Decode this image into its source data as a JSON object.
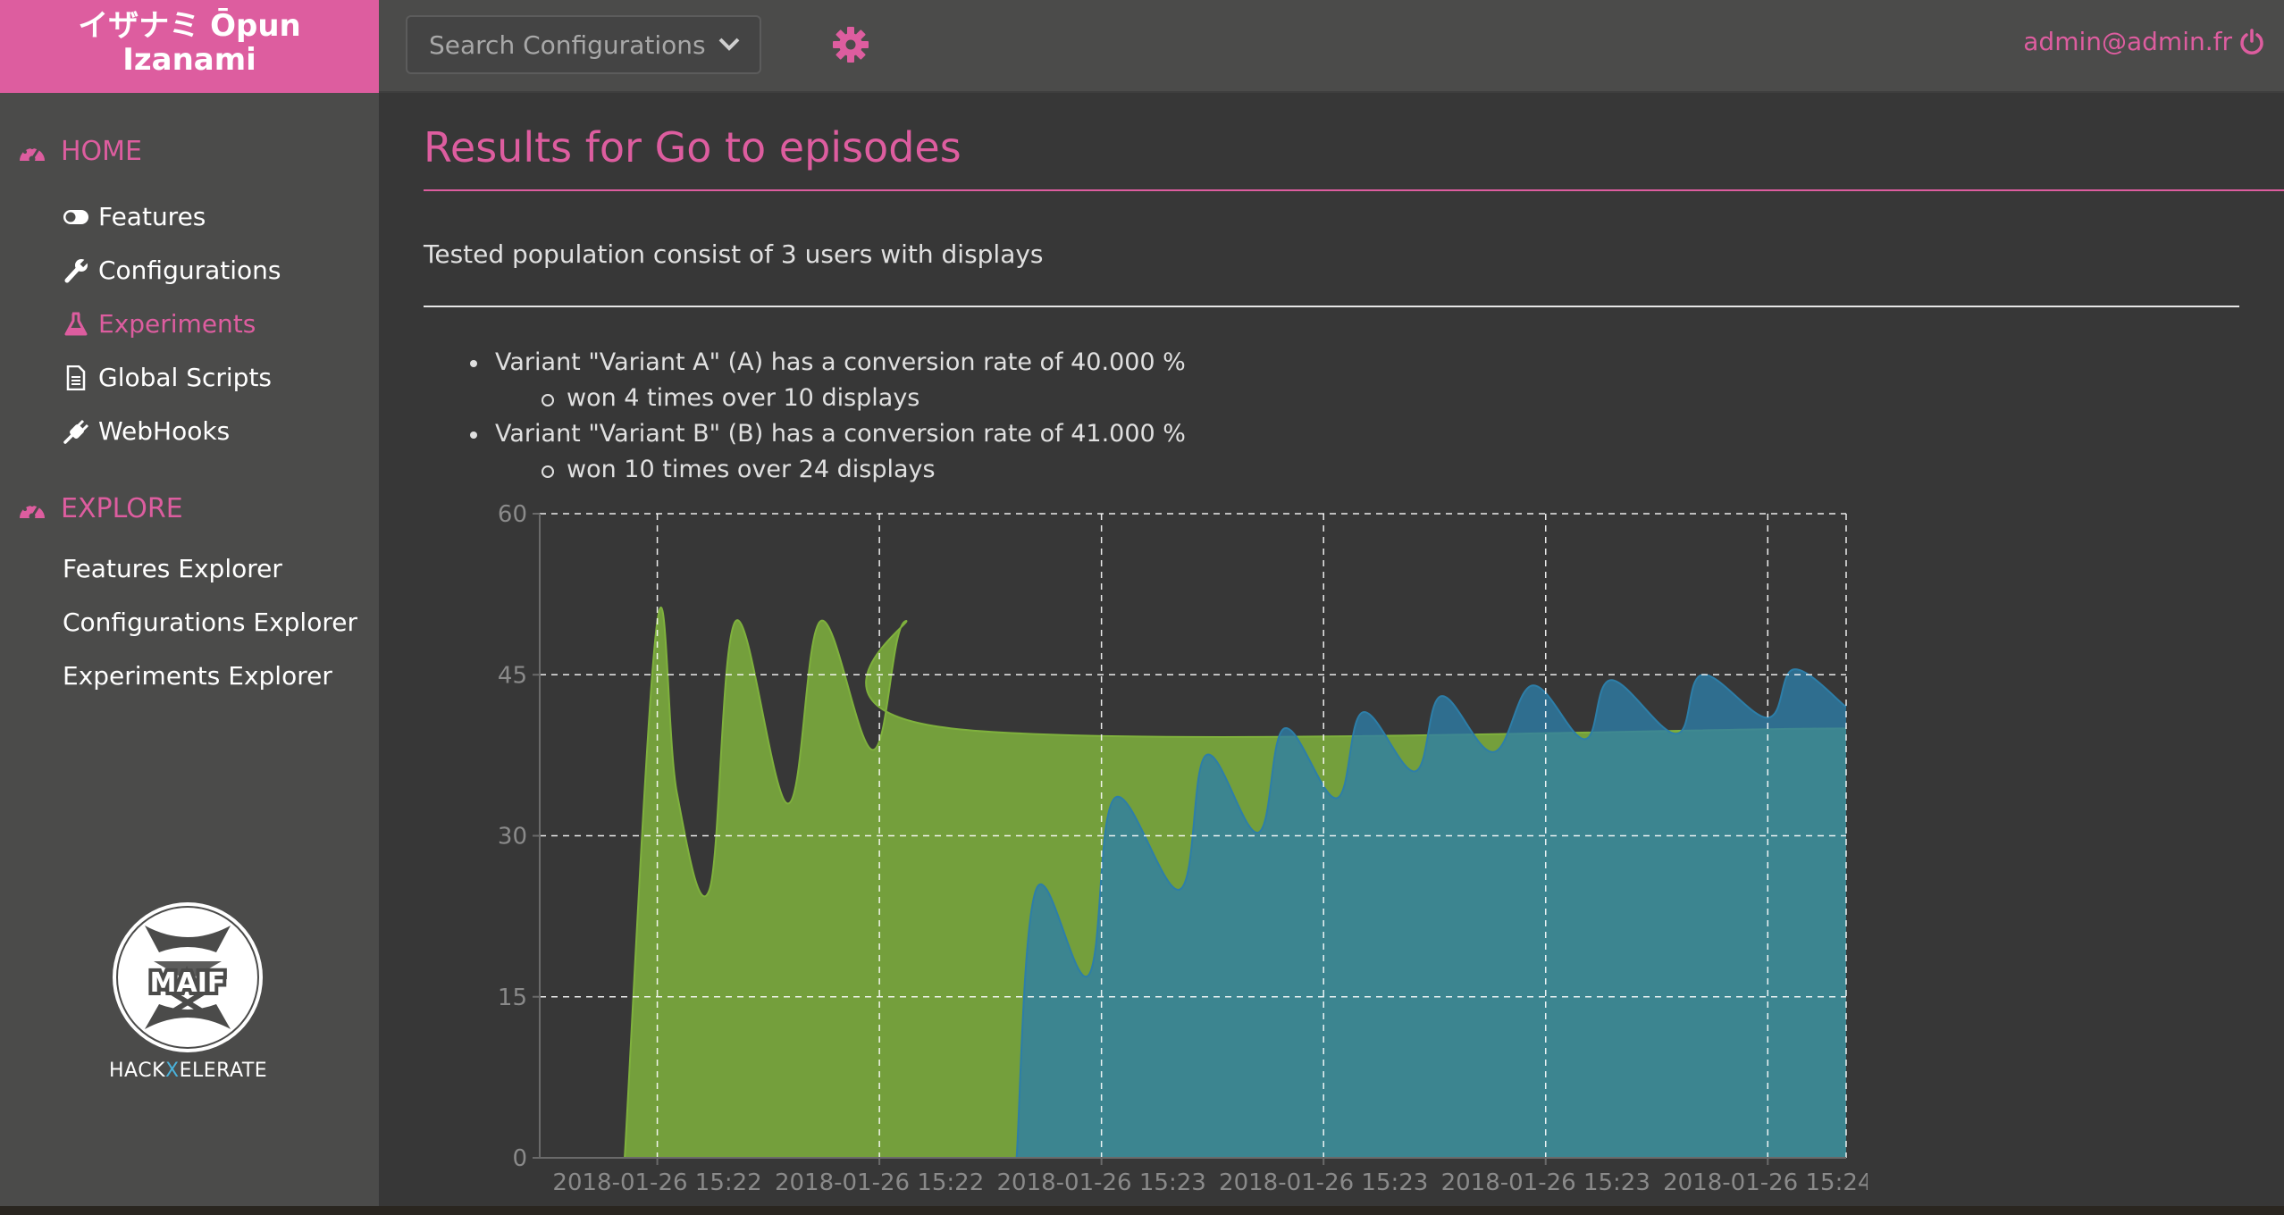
{
  "brand": {
    "line1": "イザナミ Ōpun",
    "line2": "Izanami"
  },
  "header": {
    "search_placeholder": "Search Configurations",
    "user_email": "admin@admin.fr",
    "accent_color": "#dd5d9f"
  },
  "sidebar": {
    "home_label": "HOME",
    "explore_label": "EXPLORE",
    "items": [
      {
        "label": "Features",
        "icon": "toggle-icon"
      },
      {
        "label": "Configurations",
        "icon": "wrench-icon"
      },
      {
        "label": "Experiments",
        "icon": "flask-icon",
        "active": true
      },
      {
        "label": "Global Scripts",
        "icon": "file-icon"
      },
      {
        "label": "WebHooks",
        "icon": "plug-icon"
      }
    ],
    "explore_items": [
      {
        "label": "Features Explorer"
      },
      {
        "label": "Configurations Explorer"
      },
      {
        "label": "Experiments Explorer"
      }
    ],
    "logo_text": "MAIF",
    "footer": {
      "part1": "HACK",
      "part2": "X",
      "part3": "ELERATE"
    }
  },
  "main": {
    "title": "Results for Go to episodes",
    "population_text": "Tested population consist of 3 users with displays",
    "variants": [
      {
        "summary": "Variant \"Variant A\" (A) has a conversion rate of 40.000 %",
        "detail": "won 4 times over 10 displays"
      },
      {
        "summary": "Variant \"Variant B\" (B) has a conversion rate of 41.000 %",
        "detail": "won 10 times over 24 displays"
      }
    ]
  },
  "chart_data": {
    "type": "area",
    "y_ticks": [
      0,
      15,
      30,
      45,
      60
    ],
    "ylim": [
      0,
      60
    ],
    "xlim": [
      0,
      100
    ],
    "x_tick_positions": [
      9,
      26,
      43,
      60,
      77,
      94
    ],
    "x_tick_labels": [
      "2018-01-26 15:22",
      "2018-01-26 15:22",
      "2018-01-26 15:23",
      "2018-01-26 15:23",
      "2018-01-26 15:23",
      "2018-01-26 15:24"
    ],
    "grid": true,
    "series": [
      {
        "color": "#7fb13d",
        "points": [
          [
            6.5,
            0
          ],
          [
            9,
            50
          ],
          [
            10.5,
            34
          ],
          [
            13,
            25
          ],
          [
            15,
            50
          ],
          [
            19,
            33
          ],
          [
            21.5,
            50
          ],
          [
            25.5,
            38
          ],
          [
            28,
            50
          ],
          [
            31.5,
            40
          ],
          [
            100,
            40
          ]
        ]
      },
      {
        "color": "#2d7ea8",
        "points": [
          [
            36.5,
            0
          ],
          [
            38,
            25
          ],
          [
            42,
            17
          ],
          [
            44,
            33.5
          ],
          [
            49,
            25
          ],
          [
            51,
            37.5
          ],
          [
            55,
            30.3
          ],
          [
            57,
            40
          ],
          [
            61,
            33.5
          ],
          [
            63,
            41.5
          ],
          [
            67,
            36
          ],
          [
            69,
            43
          ],
          [
            73,
            37.8
          ],
          [
            76,
            44
          ],
          [
            80,
            39
          ],
          [
            82,
            44.5
          ],
          [
            87,
            39.5
          ],
          [
            89,
            45
          ],
          [
            94,
            41
          ],
          [
            96,
            45.5
          ],
          [
            100,
            42
          ]
        ]
      }
    ]
  }
}
